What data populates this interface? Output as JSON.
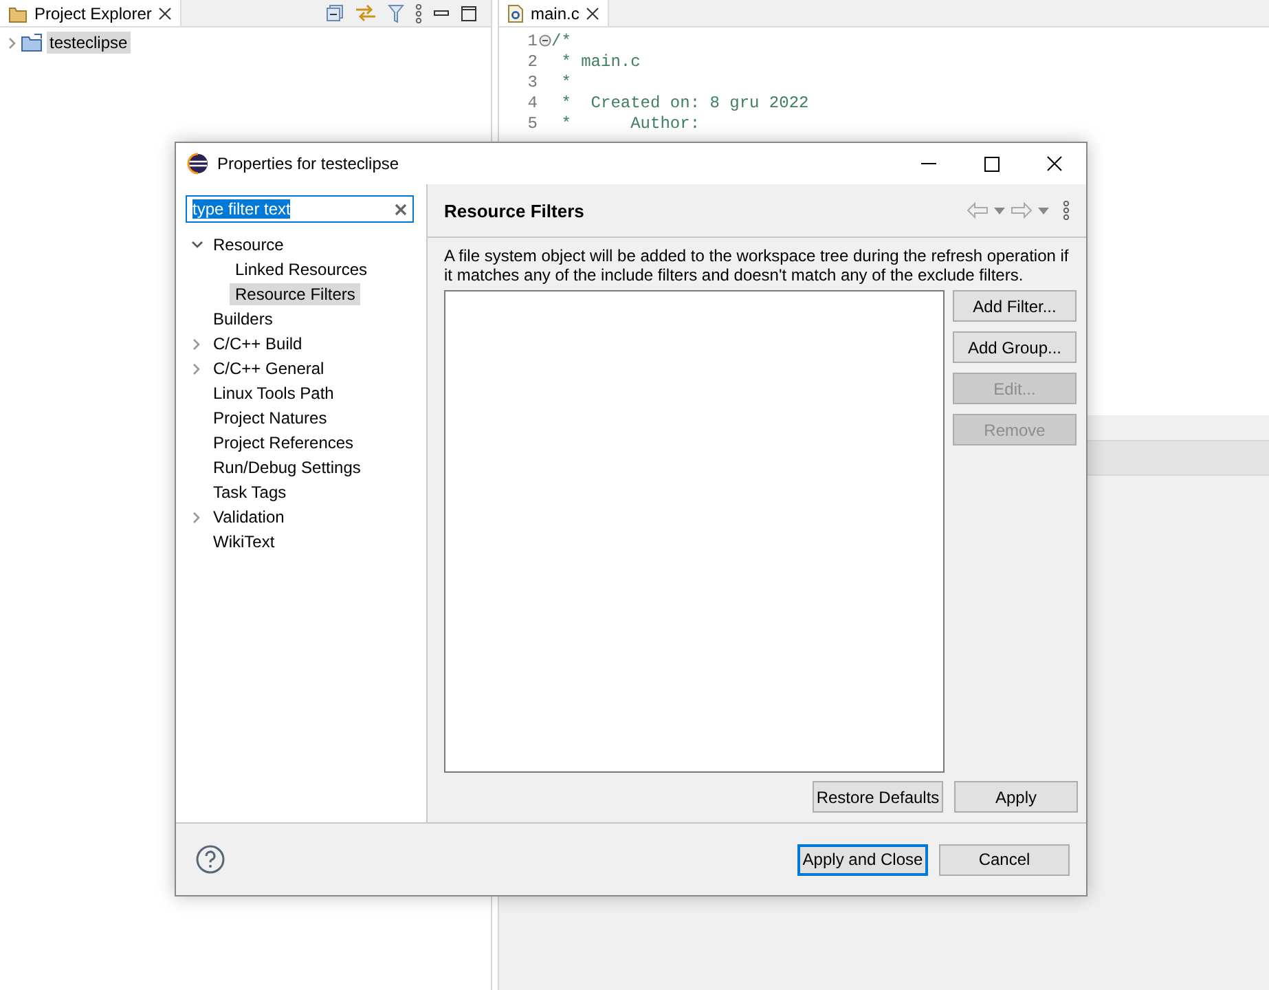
{
  "explorer": {
    "title": "Project Explorer",
    "items": [
      {
        "label": "testeclipse",
        "expanded": false,
        "selected": true
      }
    ]
  },
  "editor": {
    "tab": "main.c",
    "lines": [
      {
        "number": "1",
        "text": "/*",
        "fold": true
      },
      {
        "number": "2",
        "text": " * main.c",
        "fold": false
      },
      {
        "number": "3",
        "text": " *",
        "fold": false
      },
      {
        "number": "4",
        "text": " *  Created on: 8 gru 2022",
        "fold": false
      },
      {
        "number": "5",
        "text": " *      Author:",
        "fold": false
      }
    ]
  },
  "dialog": {
    "title": "Properties for testeclipse",
    "filter": {
      "value": "type filter text"
    },
    "tree": [
      {
        "label": "Resource",
        "expanded": true,
        "selected": false,
        "children": [
          {
            "label": "Linked Resources",
            "selected": false
          },
          {
            "label": "Resource Filters",
            "selected": true
          }
        ]
      },
      {
        "label": "Builders",
        "selected": false
      },
      {
        "label": "C/C++ Build",
        "expanded": false,
        "selected": false
      },
      {
        "label": "C/C++ General",
        "expanded": false,
        "selected": false
      },
      {
        "label": "Linux Tools Path",
        "selected": false
      },
      {
        "label": "Project Natures",
        "selected": false
      },
      {
        "label": "Project References",
        "selected": false
      },
      {
        "label": "Run/Debug Settings",
        "selected": false
      },
      {
        "label": "Task Tags",
        "selected": false
      },
      {
        "label": "Validation",
        "expanded": false,
        "selected": false
      },
      {
        "label": "WikiText",
        "selected": false
      }
    ],
    "page_title": "Resource Filters",
    "description": "A file system object will be added to the workspace tree during the refresh operation if it matches any of the include filters and doesn't match any of the exclude filters.",
    "side_buttons": [
      {
        "label": "Add Filter...",
        "disabled": false
      },
      {
        "label": "Add Group...",
        "disabled": false
      },
      {
        "label": "Edit...",
        "disabled": true
      },
      {
        "label": "Remove",
        "disabled": true
      }
    ],
    "page_buttons": [
      {
        "label": "Restore Defaults",
        "disabled": false
      },
      {
        "label": "Apply",
        "disabled": false
      }
    ],
    "footer_buttons": [
      {
        "label": "Apply and Close",
        "default": true
      },
      {
        "label": "Cancel",
        "default": false
      }
    ]
  }
}
